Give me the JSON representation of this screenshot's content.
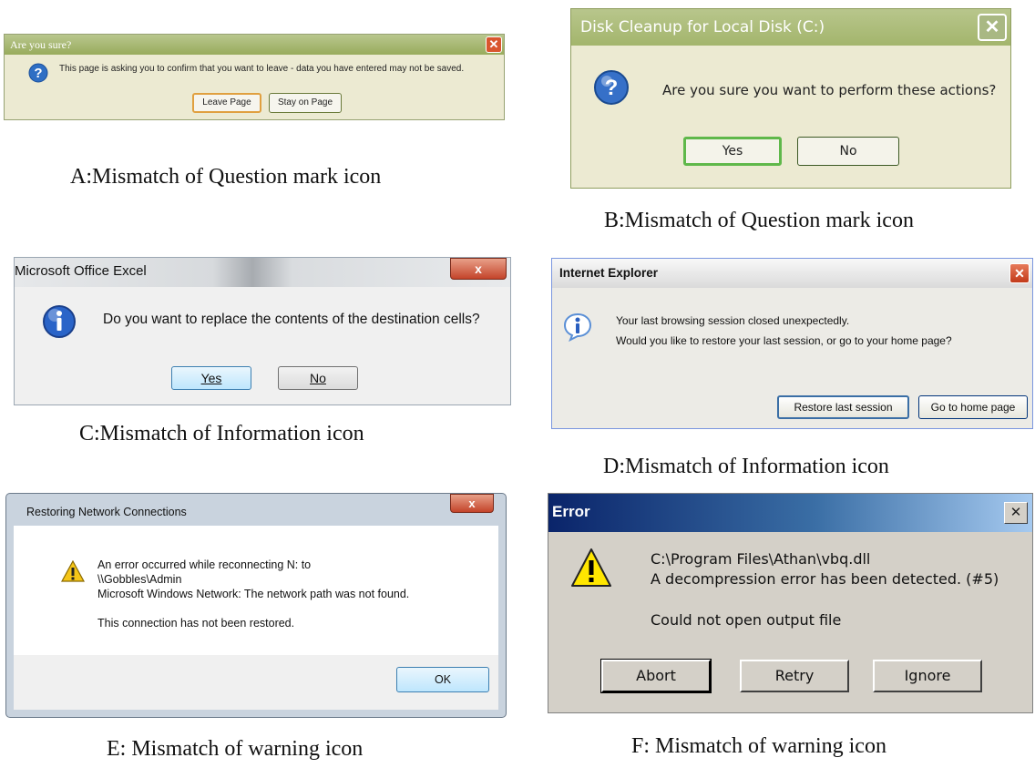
{
  "dialog_a": {
    "title": "Are you sure?",
    "message": "This page is asking you to confirm that you want to leave - data you have entered may not be saved.",
    "buttons": [
      "Leave Page",
      "Stay on Page"
    ],
    "caption": "A:Mismatch of Question mark icon",
    "icon": "question-icon"
  },
  "dialog_b": {
    "title": "Disk Cleanup for Local Disk (C:)",
    "message": "Are you sure you want to perform these actions?",
    "buttons": [
      "Yes",
      "No"
    ],
    "caption": "B:Mismatch of Question mark icon",
    "icon": "question-icon"
  },
  "dialog_c": {
    "title": "Microsoft Office Excel",
    "message": "Do you want to replace the contents of the destination cells?",
    "buttons": [
      "Yes",
      "No"
    ],
    "caption": "C:Mismatch of Information icon",
    "icon": "info-icon"
  },
  "dialog_d": {
    "title": "Internet Explorer",
    "message_lines": [
      "Your last browsing session closed unexpectedly.",
      "Would you like to restore your last session, or go to your home page?"
    ],
    "buttons": [
      "Restore last session",
      "Go to home page"
    ],
    "caption": "D:Mismatch of Information icon",
    "icon": "info-icon"
  },
  "dialog_e": {
    "title": "Restoring Network Connections",
    "message_lines": [
      "An error occurred while reconnecting N: to",
      "\\\\Gobbles\\Admin",
      "Microsoft Windows Network: The network path was not found."
    ],
    "message_extra": "This connection has not been restored.",
    "buttons": [
      "OK"
    ],
    "caption": "E: Mismatch of warning icon",
    "icon": "warning-icon"
  },
  "dialog_f": {
    "title": "Error",
    "message_lines": [
      "C:\\Program Files\\Athan\\vbq.dll",
      "A decompression error has been detected. (#5)"
    ],
    "message_extra": "Could not open output file",
    "buttons": [
      "Abort",
      "Retry",
      "Ignore"
    ],
    "caption": "F: Mismatch of warning icon",
    "icon": "warning-icon"
  },
  "colors": {
    "xp_olive_title": "#a3b56c",
    "xp_olive_body": "#ecead2",
    "close_red": "#d9562e",
    "classic_blue": "#0a246a",
    "classic_gray": "#d4d0c8",
    "win7_frame": "#c9d3de"
  }
}
